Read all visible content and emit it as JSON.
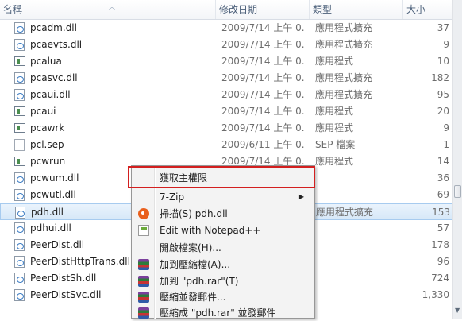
{
  "columns": {
    "name": "名稱",
    "date": "修改日期",
    "type": "類型",
    "size": "大小"
  },
  "files": [
    {
      "name": "pcadm.dll",
      "date": "2009/7/14 上午 0...",
      "type": "應用程式擴充",
      "size": "37",
      "icon": "dll-file-icon"
    },
    {
      "name": "pcaevts.dll",
      "date": "2009/7/14 上午 0...",
      "type": "應用程式擴充",
      "size": "9",
      "icon": "dll-file-icon"
    },
    {
      "name": "pcalua",
      "date": "2009/7/14 上午 0...",
      "type": "應用程式",
      "size": "10",
      "icon": "executable-icon"
    },
    {
      "name": "pcasvc.dll",
      "date": "2009/7/14 上午 0...",
      "type": "應用程式擴充",
      "size": "182",
      "icon": "dll-file-icon"
    },
    {
      "name": "pcaui.dll",
      "date": "2009/7/14 上午 0...",
      "type": "應用程式擴充",
      "size": "95",
      "icon": "dll-file-icon"
    },
    {
      "name": "pcaui",
      "date": "2009/7/14 上午 0...",
      "type": "應用程式",
      "size": "20",
      "icon": "executable-icon"
    },
    {
      "name": "pcawrk",
      "date": "2009/7/14 上午 0...",
      "type": "應用程式",
      "size": "9",
      "icon": "executable-icon"
    },
    {
      "name": "pcl.sep",
      "date": "2009/6/11 上午 0...",
      "type": "SEP 檔案",
      "size": "1",
      "icon": "document-icon"
    },
    {
      "name": "pcwrun",
      "date": "2009/7/14 上午 0...",
      "type": "應用程式",
      "size": "14",
      "icon": "executable-icon"
    },
    {
      "name": "pcwum.dll",
      "date": "",
      "type": "",
      "size": "36",
      "icon": "dll-file-icon"
    },
    {
      "name": "pcwutl.dll",
      "date": "",
      "type": "",
      "size": "69",
      "icon": "dll-file-icon"
    },
    {
      "name": "pdh.dll",
      "date": "",
      "type": "應用程式擴充",
      "size": "153",
      "icon": "dll-file-icon",
      "selected": true
    },
    {
      "name": "pdhui.dll",
      "date": "",
      "type": "",
      "size": "57",
      "icon": "dll-file-icon"
    },
    {
      "name": "PeerDist.dll",
      "date": "",
      "type": "",
      "size": "178",
      "icon": "dll-file-icon"
    },
    {
      "name": "PeerDistHttpTrans.dll",
      "date": "",
      "type": "",
      "size": "96",
      "icon": "dll-file-icon"
    },
    {
      "name": "PeerDistSh.dll",
      "date": "",
      "type": "",
      "size": "724",
      "icon": "dll-file-icon"
    },
    {
      "name": "PeerDistSvc.dll",
      "date": "",
      "type": "",
      "size": "1,330",
      "icon": "dll-file-icon"
    }
  ],
  "context_menu": {
    "items": [
      {
        "label": "獲取主權限",
        "icon": ""
      },
      {
        "label": "7-Zip",
        "icon": "",
        "submenu": true
      },
      {
        "label": "掃描(S) pdh.dll",
        "icon": "scan-icon"
      },
      {
        "label": "Edit with Notepad++",
        "icon": "notepad-plus-plus-icon"
      },
      {
        "label": "開啟檔案(H)...",
        "icon": ""
      },
      {
        "label": "加到壓縮檔(A)...",
        "icon": "winrar-icon"
      },
      {
        "label": "加到 \"pdh.rar\"(T)",
        "icon": "winrar-icon"
      },
      {
        "label": "壓縮並發郵件...",
        "icon": "winrar-icon"
      },
      {
        "label": "壓縮成 \"pdh.rar\" 並發郵件",
        "icon": "winrar-icon"
      }
    ],
    "submenu_arrow": "▶"
  },
  "sort_indicator": "︿",
  "colors": {
    "highlight_box": "#d31f1f",
    "selection_bg": "#d7e8f8",
    "header_text": "#4c607a"
  }
}
